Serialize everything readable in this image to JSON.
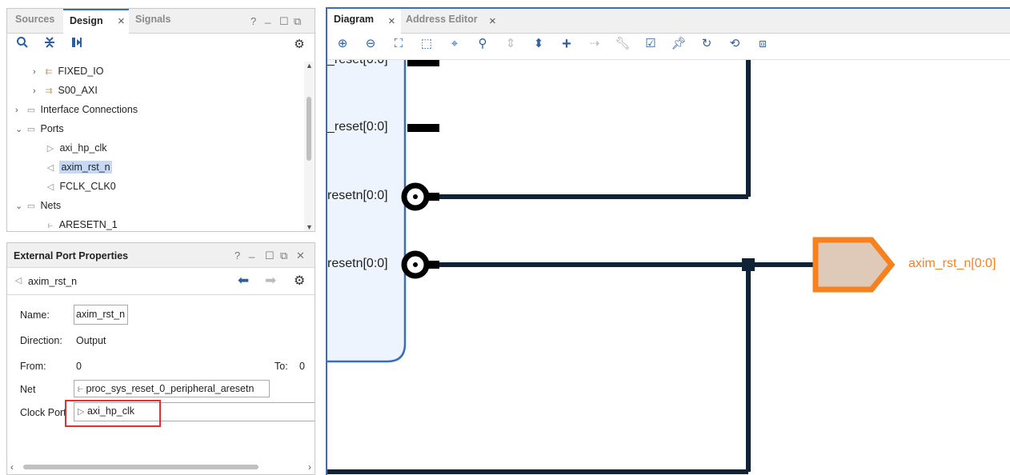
{
  "sources_panel": {
    "tabs": [
      {
        "label": "Sources"
      },
      {
        "label": "Design"
      },
      {
        "label": "Signals"
      }
    ],
    "winctl": {
      "help": "?",
      "min": "_",
      "max": "☐",
      "float": "⧉"
    },
    "tree": [
      {
        "label": "FIXED_IO"
      },
      {
        "label": "S00_AXI"
      },
      {
        "label": "Interface Connections"
      },
      {
        "label": "Ports"
      },
      {
        "label": "axi_hp_clk"
      },
      {
        "label": "axim_rst_n"
      },
      {
        "label": "FCLK_CLK0"
      },
      {
        "label": "Nets"
      },
      {
        "label": "ARESETN_1"
      }
    ]
  },
  "props_panel": {
    "title": "External Port Properties",
    "winctl": {
      "help": "?",
      "min": "_",
      "max": "☐",
      "float": "⧉",
      "close": "✕"
    },
    "object_name": "axim_rst_n",
    "fields": {
      "name_label": "Name:",
      "name_value": "axim_rst_n",
      "direction_label": "Direction:",
      "direction_value": "Output",
      "from_label": "From:",
      "from_value": "0",
      "to_label": "To:",
      "to_value": "0",
      "net_label": "Net",
      "net_value": "proc_sys_reset_0_peripheral_aresetn",
      "clock_label": "Clock Port",
      "clock_value": "axi_hp_clk"
    },
    "highlight_color": "#e03030"
  },
  "diagram_panel": {
    "tabs": [
      {
        "label": "Diagram"
      },
      {
        "label": "Address Editor"
      }
    ],
    "pins": [
      {
        "label": "_reset[0:0]"
      },
      {
        "label": "_reset[0:0]"
      },
      {
        "label": "resetn[0:0]"
      },
      {
        "label": "resetn[0:0]"
      }
    ],
    "port_label": "axim_rst_n[0:0]",
    "port_color": "#f5821f",
    "wire_color": "#0f2236",
    "block_border": "#3b6fb5"
  }
}
